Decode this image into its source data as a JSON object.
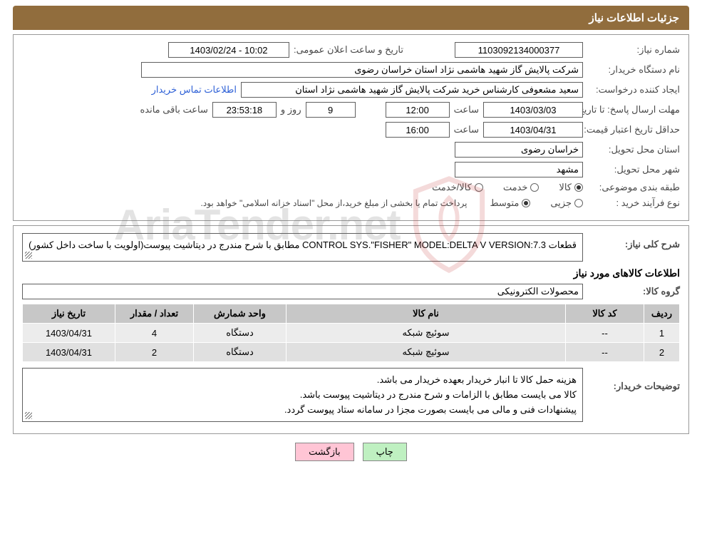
{
  "title": "جزئیات اطلاعات نیاز",
  "labels": {
    "need_no": "شماره نیاز:",
    "public_announce": "تاریخ و ساعت اعلان عمومی:",
    "buyer_org": "نام دستگاه خریدار:",
    "requester": "ایجاد کننده درخواست:",
    "buyer_contact": "اطلاعات تماس خریدار",
    "reply_deadline": "مهلت ارسال پاسخ:",
    "until_date": "تا تاریخ:",
    "hour": "ساعت",
    "days_and": "روز و",
    "hours_left": "ساعت باقی مانده",
    "price_validity": "حداقل تاریخ اعتبار قیمت:",
    "delivery_province": "استان محل تحویل:",
    "delivery_city": "شهر محل تحویل:",
    "topic_class": "طبقه بندی موضوعی:",
    "purchase_type": "نوع فرآیند خرید :",
    "goods": "کالا",
    "service": "خدمت",
    "goods_service": "کالا/خدمت",
    "partial": "جزیی",
    "medium": "متوسط",
    "purchase_note": "پرداخت تمام یا بخشی از مبلغ خرید،از محل \"اسناد خزانه اسلامی\" خواهد بود.",
    "need_desc": "شرح کلی نیاز:",
    "items_info": "اطلاعات کالاهای مورد نیاز",
    "goods_group": "گروه کالا:",
    "th_row": "ردیف",
    "th_code": "کد کالا",
    "th_name": "نام کالا",
    "th_unit": "واحد شمارش",
    "th_qty": "تعداد / مقدار",
    "th_need_date": "تاریخ نیاز",
    "buyer_notes": "توضیحات خریدار:",
    "btn_print": "چاپ",
    "btn_back": "بازگشت"
  },
  "values": {
    "need_no": "1103092134000377",
    "public_announce": "1403/02/24 - 10:02",
    "buyer_org": "شرکت پالایش گاز شهید هاشمی نژاد   استان خراسان رضوی",
    "requester": "سعید مشعوفی کارشناس خرید شرکت پالایش گاز شهید هاشمی نژاد   استان",
    "reply_date": "1403/03/03",
    "reply_hour": "12:00",
    "days_left": "9",
    "time_left": "23:53:18",
    "price_date": "1403/04/31",
    "price_hour": "16:00",
    "province": "خراسان رضوی",
    "city": "مشهد",
    "need_desc_text": "قطعات CONTROL SYS.\"FISHER\"  MODEL:DELTA V   VERSION:7.3 مطابق با شرح مندرج در دیتاشیت پیوست(اولویت با ساخت داخل کشور)",
    "goods_group_val": "محصولات الکترونیکی",
    "notes_line1": "هزینه حمل کالا تا انبار خریدار بعهده خریدار می باشد.",
    "notes_line2": "کالا می بایست مطابق با الزامات و شرح مندرج در دیتاشیت پیوست باشد.",
    "notes_line3": "پیشنهادات فنی و مالی می بایست بصورت مجزا در سامانه ستاد پیوست گردد."
  },
  "items": [
    {
      "row": "1",
      "code": "--",
      "name": "سوئیچ شبکه",
      "unit": "دستگاه",
      "qty": "4",
      "need_date": "1403/04/31"
    },
    {
      "row": "2",
      "code": "--",
      "name": "سوئیچ شبکه",
      "unit": "دستگاه",
      "qty": "2",
      "need_date": "1403/04/31"
    }
  ],
  "watermark": "AriaTender.net"
}
